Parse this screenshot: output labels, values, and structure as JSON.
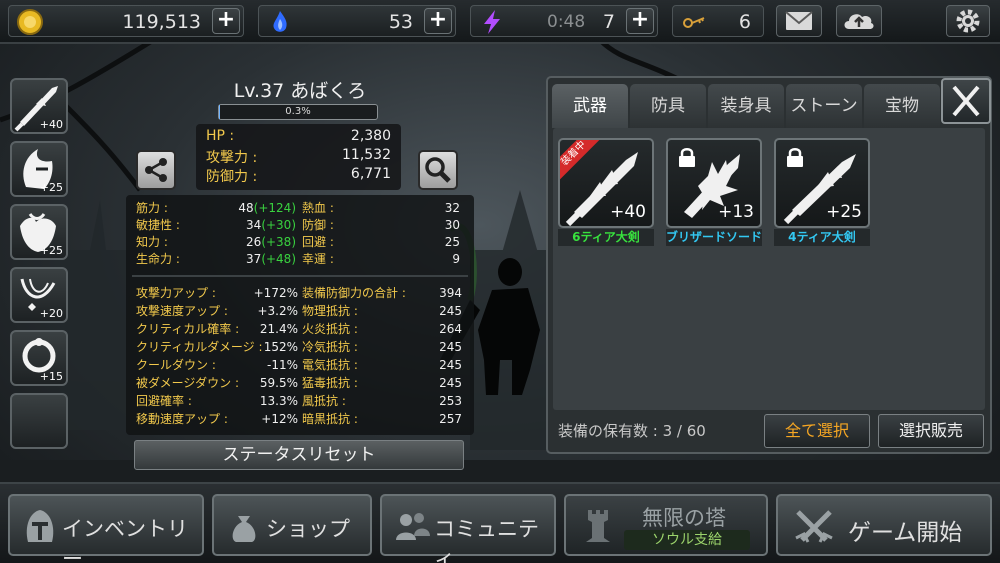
{
  "resources": {
    "gold": "119,513",
    "soul": "53",
    "energy_timer": "0:48",
    "energy": "7",
    "keys": "6"
  },
  "side_items": [
    {
      "name": "sword-slot",
      "level": "+40"
    },
    {
      "name": "helmet-slot",
      "level": "+25"
    },
    {
      "name": "armor-slot",
      "level": "+25"
    },
    {
      "name": "necklace-slot",
      "level": "+20"
    },
    {
      "name": "ring-slot",
      "level": "+15"
    },
    {
      "name": "empty-slot",
      "level": ""
    }
  ],
  "character": {
    "title": "Lv.37 あばくろ",
    "xp": "0.3%",
    "xp_fraction": 0.003,
    "summary": [
      {
        "label": "HP :",
        "value": "2,380"
      },
      {
        "label": "攻撃力 :",
        "value": "11,532"
      },
      {
        "label": "防御力 :",
        "value": "6,771"
      }
    ],
    "base_stats_left": [
      {
        "label": "筋力 :",
        "value": "48",
        "bonus": "(+124)"
      },
      {
        "label": "敏捷性 :",
        "value": "34",
        "bonus": "(+30)"
      },
      {
        "label": "知力 :",
        "value": "26",
        "bonus": "(+38)"
      },
      {
        "label": "生命力 :",
        "value": "37",
        "bonus": "(+48)"
      }
    ],
    "base_stats_right": [
      {
        "label": "熱血 :",
        "value": "32"
      },
      {
        "label": "防御 :",
        "value": "30"
      },
      {
        "label": "回避 :",
        "value": "25"
      },
      {
        "label": "幸運 :",
        "value": "9"
      }
    ],
    "bonus_left": [
      {
        "label": "攻撃力アップ :",
        "value": "+172%"
      },
      {
        "label": "攻撃速度アップ :",
        "value": "+3.2%"
      },
      {
        "label": "クリティカル確率 :",
        "value": "21.4%"
      },
      {
        "label": "クリティカルダメージ :",
        "value": "152%"
      },
      {
        "label": "クールダウン :",
        "value": "-11%"
      },
      {
        "label": "被ダメージダウン :",
        "value": "59.5%"
      },
      {
        "label": "回避確率 :",
        "value": "13.3%"
      },
      {
        "label": "移動速度アップ :",
        "value": "+12%"
      }
    ],
    "bonus_right": [
      {
        "label": "装備防御力の合計 :",
        "value": "394"
      },
      {
        "label": "物理抵抗 :",
        "value": "245"
      },
      {
        "label": "火炎抵抗 :",
        "value": "264"
      },
      {
        "label": "冷気抵抗 :",
        "value": "245"
      },
      {
        "label": "電気抵抗 :",
        "value": "245"
      },
      {
        "label": "猛毒抵抗 :",
        "value": "245"
      },
      {
        "label": "風抵抗 :",
        "value": "253"
      },
      {
        "label": "暗黒抵抗 :",
        "value": "257"
      }
    ],
    "reset_label": "ステータスリセット"
  },
  "inventory": {
    "tabs": [
      "武器",
      "防具",
      "装身具",
      "ストーン",
      "宝物"
    ],
    "active_tab": "武器",
    "items": [
      {
        "name": "6ティア大剣",
        "level": "+40",
        "badge": "装着中",
        "color": "#38e23e"
      },
      {
        "name": "ブリザードソード",
        "level": "+13",
        "badge": "",
        "color": "#33c8f2"
      },
      {
        "name": "4ティア大剣",
        "level": "+25",
        "badge": "",
        "color": "#33c8f2"
      }
    ],
    "count_label": "装備の保有数 : 3 / 60",
    "select_all": "全て選択",
    "sell_selected": "選択販売"
  },
  "nav": {
    "inventory": "インベントリー",
    "shop": "ショップ",
    "community": "コミュニティ",
    "tower": "無限の塔",
    "tower_sub": "ソウル支給",
    "start": "ゲーム開始"
  },
  "colors": {
    "stat_label": "#f2c94c",
    "stat_bonus": "#39d13f",
    "select_all_text": "#f5a623"
  }
}
